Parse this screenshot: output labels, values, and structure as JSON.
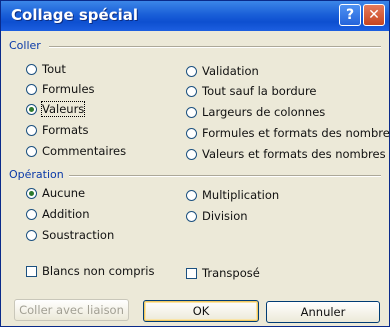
{
  "dialog": {
    "title": "Collage spécial",
    "help_glyph": "?",
    "close_glyph": "✕"
  },
  "paste_section": {
    "label": "Coller",
    "left": [
      "Tout",
      "Formules",
      "Valeurs",
      "Formats",
      "Commentaires"
    ],
    "right": [
      "Validation",
      "Tout sauf la bordure",
      "Largeurs de colonnes",
      "Formules et formats des nombres",
      "Valeurs et formats des nombres"
    ],
    "selected": "Valeurs"
  },
  "operation_section": {
    "label": "Opération",
    "left": [
      "Aucune",
      "Addition",
      "Soustraction"
    ],
    "right": [
      "Multiplication",
      "Division"
    ],
    "selected": "Aucune"
  },
  "checkboxes": {
    "skip_blanks": "Blancs non compris",
    "transpose": "Transposé"
  },
  "buttons": {
    "paste_link": "Coller avec liaison",
    "ok": "OK",
    "cancel": "Annuler"
  }
}
